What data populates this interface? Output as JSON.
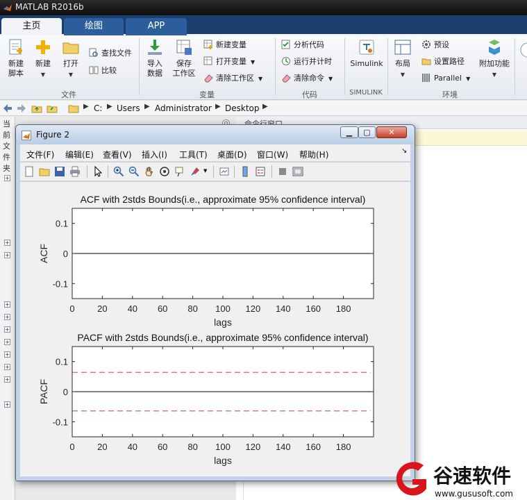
{
  "window": {
    "title": "MATLAB R2016b"
  },
  "tabs": [
    {
      "label": "主页",
      "active": true
    },
    {
      "label": "绘图",
      "active": false
    },
    {
      "label": "APP",
      "active": false
    }
  ],
  "ribbon": {
    "file": {
      "group_label": "文件",
      "new_script": "新建\n脚本",
      "new": "新建",
      "open": "打开",
      "find_files": "查找文件",
      "compare": "比较"
    },
    "variable": {
      "group_label": "变量",
      "import": "导入\n数据",
      "save_workspace": "保存\n工作区",
      "new_variable": "新建变量",
      "open_variable": "打开变量",
      "clear_workspace": "清除工作区"
    },
    "code": {
      "group_label": "代码",
      "analyze": "分析代码",
      "run_time": "运行并计时",
      "clear_commands": "清除命令"
    },
    "simulink": {
      "group_label": "SIMULINK",
      "label": "Simulink"
    },
    "environment": {
      "group_label": "环境",
      "layout": "布局",
      "preferences": "预设",
      "set_path": "设置路径",
      "parallel": "Parallel",
      "addons": "附加功能"
    }
  },
  "address": {
    "crumbs": [
      "C:",
      "Users",
      "Administrator",
      "Desktop"
    ]
  },
  "left_panel": {
    "title": "当前文件夹"
  },
  "right_panel": {
    "title": "命令行窗口"
  },
  "figure": {
    "title": "Figure 2",
    "menu": [
      "文件(F)",
      "编辑(E)",
      "查看(V)",
      "插入(I)",
      "工具(T)",
      "桌面(D)",
      "窗口(W)",
      "帮助(H)"
    ]
  },
  "chart_data": [
    {
      "type": "line",
      "title": "ACF with  2stds Bounds(i.e., approximate 95% confidence interval)",
      "xlabel": "lags",
      "ylabel": "ACF",
      "xlim": [
        0,
        200
      ],
      "ylim": [
        -0.15,
        0.15
      ],
      "xticks": [
        0,
        20,
        40,
        60,
        80,
        100,
        120,
        140,
        160,
        180
      ],
      "yticks": [
        0.1,
        0,
        -0.1
      ],
      "grid": false,
      "series": [
        {
          "x": [
            0,
            200
          ],
          "values": [
            0,
            0
          ],
          "color": "#000000",
          "style": "solid"
        }
      ]
    },
    {
      "type": "line",
      "title": "PACF with  2stds Bounds(i.e., approximate 95% confidence interval)",
      "xlabel": "lags",
      "ylabel": "PACF",
      "xlim": [
        0,
        200
      ],
      "ylim": [
        -0.15,
        0.15
      ],
      "xticks": [
        0,
        20,
        40,
        60,
        80,
        100,
        120,
        140,
        160,
        180
      ],
      "yticks": [
        0.1,
        0,
        -0.1
      ],
      "grid": false,
      "series": [
        {
          "x": [
            0,
            200
          ],
          "values": [
            0,
            0
          ],
          "color": "#000000",
          "style": "solid"
        },
        {
          "x": [
            0,
            198
          ],
          "values": [
            0.064,
            0.064
          ],
          "color": "#e06060",
          "style": "dashed"
        },
        {
          "x": [
            0,
            198
          ],
          "values": [
            -0.064,
            -0.064
          ],
          "color": "#e06060",
          "style": "dashed"
        }
      ]
    }
  ],
  "watermark": {
    "brand": "谷速软件",
    "url": "www.gususoft.com"
  },
  "colors": {
    "tab_bar": "#1b3e6f",
    "tab_inactive": "#2c5e9e",
    "bound_line": "#e06060"
  }
}
